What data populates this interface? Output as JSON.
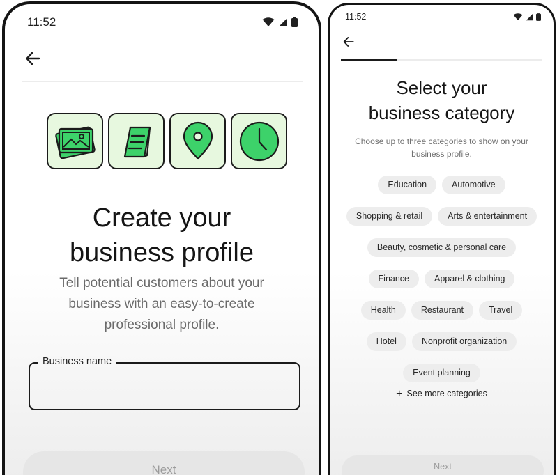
{
  "left_screen": {
    "status": {
      "time": "11:52"
    },
    "title_line1": "Create your",
    "title_line2": "business profile",
    "subtitle": "Tell potential customers about your business with an easy-to-create professional profile.",
    "field": {
      "label": "Business name",
      "value": ""
    },
    "next_button": "Next",
    "icons": [
      "back-arrow-icon",
      "photos-icon",
      "menu-card-icon",
      "location-pin-icon",
      "clock-icon",
      "wifi-icon",
      "cellular-icon",
      "battery-icon"
    ]
  },
  "right_screen": {
    "status": {
      "time": "11:52"
    },
    "progress": 0.28,
    "title_line1": "Select your",
    "title_line2": "business category",
    "subtitle": "Choose up to three categories to show on your business profile.",
    "categories": [
      "Education",
      "Automotive",
      "Shopping & retail",
      "Arts & entertainment",
      "Beauty, cosmetic & personal care",
      "Finance",
      "Apparel & clothing",
      "Health",
      "Restaurant",
      "Travel",
      "Hotel",
      "Nonprofit organization",
      "Event planning"
    ],
    "see_more": "See more categories",
    "next_button": "Next"
  },
  "colors": {
    "tile_fill": "#e7f8df",
    "icon_green": "#3dd26a",
    "outline": "#1b1b1b",
    "chip_bg": "#ededed",
    "disabled_button": "#e6e6e6"
  }
}
